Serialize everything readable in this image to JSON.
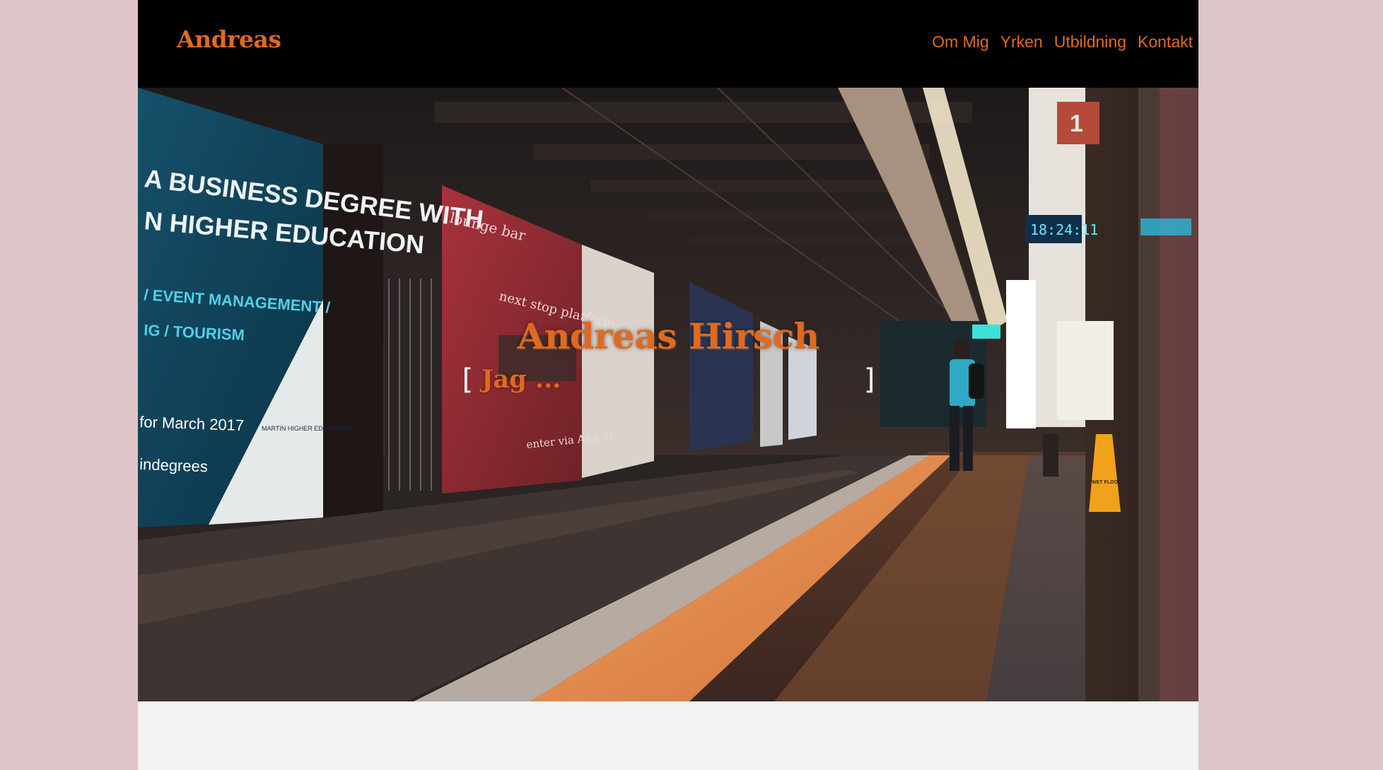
{
  "header": {
    "brand": "Andreas",
    "nav": [
      {
        "label": "Om Mig"
      },
      {
        "label": "Yrken"
      },
      {
        "label": "Utbildning"
      },
      {
        "label": "Kontakt"
      }
    ]
  },
  "hero": {
    "title": "Andreas Hirsch",
    "bracket_left": "[",
    "typed_text": "Jag ...",
    "bracket_right": "]",
    "background_image": {
      "sign_big": "A BUSINESS DEGREE WITH",
      "sign_big_2": "N HIGHER EDUCATION",
      "sign_event": "/ EVENT MANAGEMENT /",
      "sign_tourism": "IG / TOURISM",
      "sign_date": "for March 2017",
      "sign_web": "indegrees",
      "logo_text": "MARTIN HIGHER EDUCATION",
      "lounge": "lounge bar",
      "nextstop": "next stop platform",
      "enter": "enter via Ann St.",
      "clock": "18:24:11",
      "platform": "1",
      "wetfloor": "WET FLOOR"
    }
  },
  "colors": {
    "accent": "#e06a1f",
    "outer_bg": "#dfc4c9",
    "header_bg": "#000000",
    "content_bg": "#f2f2f2"
  }
}
